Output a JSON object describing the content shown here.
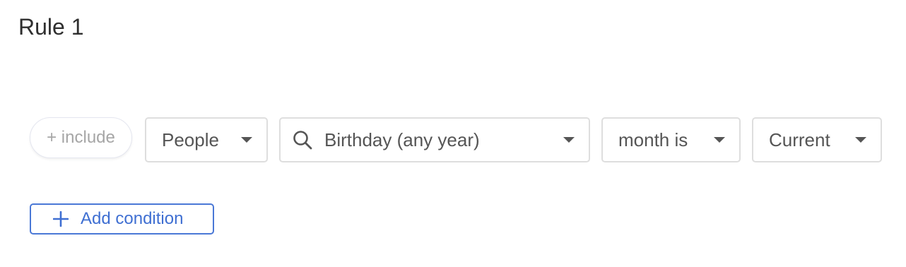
{
  "rule": {
    "title": "Rule 1"
  },
  "condition": {
    "include_label": "+ include",
    "entity_select": {
      "value": "People"
    },
    "field_select": {
      "value": "Birthday (any year)",
      "icon": "search-icon"
    },
    "operator_select": {
      "value": "month is"
    },
    "value_select": {
      "value": "Current"
    }
  },
  "actions": {
    "add_condition_label": "Add condition",
    "add_icon": "plus-icon"
  },
  "colors": {
    "accent": "#3f6fd2",
    "border": "#dedede",
    "muted_text": "#a6a6a6"
  }
}
